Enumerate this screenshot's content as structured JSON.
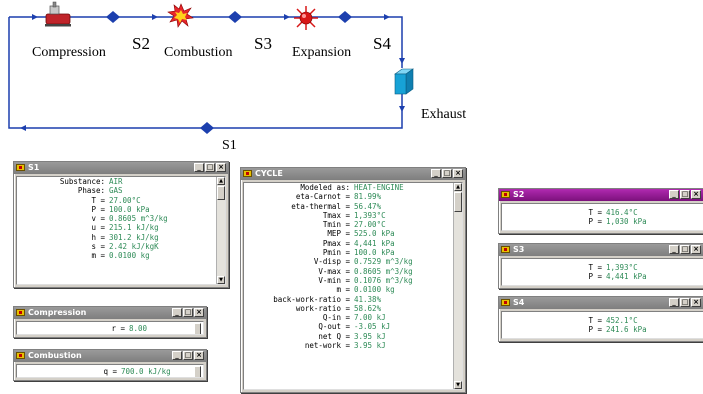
{
  "diagram": {
    "labels": {
      "compression": "Compression",
      "s2": "S2",
      "combustion": "Combustion",
      "s3": "S3",
      "expansion": "Expansion",
      "s4": "S4",
      "exhaust": "Exhaust",
      "s1": "S1"
    },
    "colors": {
      "line": "#1c3fae",
      "node": "#1c3fae",
      "compressor": "#c0242a",
      "exhaust": "#17a2d6"
    }
  },
  "windows": {
    "s1": {
      "title": "S1",
      "rows": [
        {
          "label": "Substance:",
          "value": "AIR"
        },
        {
          "label": "Phase:",
          "value": "GAS"
        },
        {
          "label": "T =",
          "value": "27.00°C"
        },
        {
          "label": "P =",
          "value": "100.0 kPa"
        },
        {
          "label": "v =",
          "value": "0.8605 m^3/kg"
        },
        {
          "label": "u =",
          "value": "215.1 kJ/kg"
        },
        {
          "label": "h =",
          "value": "301.2 kJ/kg"
        },
        {
          "label": "s =",
          "value": "2.42 kJ/kgK"
        },
        {
          "label": "m =",
          "value": "0.0100 kg"
        }
      ]
    },
    "compression": {
      "title": "Compression",
      "rows": [
        {
          "label": "r =",
          "value": "8.00"
        }
      ]
    },
    "combustion": {
      "title": "Combustion",
      "rows": [
        {
          "label": "q =",
          "value": "700.0 kJ/kg"
        }
      ]
    },
    "cycle": {
      "title": "CYCLE",
      "rows": [
        {
          "label": "Modeled as:",
          "value": "HEAT-ENGINE"
        },
        {
          "label": "eta-Carnot =",
          "value": "81.99%"
        },
        {
          "label": "eta-thermal =",
          "value": "56.47%"
        },
        {
          "label": "Tmax =",
          "value": "1,393°C"
        },
        {
          "label": "Tmin =",
          "value": "27.00°C"
        },
        {
          "label": "MEP =",
          "value": "525.0 kPa"
        },
        {
          "label": "Pmax =",
          "value": "4,441 kPa"
        },
        {
          "label": "Pmin =",
          "value": "100.0 kPa"
        },
        {
          "label": "V-disp =",
          "value": "0.7529 m^3/kg"
        },
        {
          "label": "V-max =",
          "value": "0.8605 m^3/kg"
        },
        {
          "label": "V-min =",
          "value": "0.1076 m^3/kg"
        },
        {
          "label": "m =",
          "value": "0.0100 kg"
        },
        {
          "label": "back-work-ratio =",
          "value": "41.38%"
        },
        {
          "label": "work-ratio =",
          "value": "58.62%"
        },
        {
          "label": "Q-in =",
          "value": "7.00 kJ"
        },
        {
          "label": "Q-out =",
          "value": "-3.05 kJ"
        },
        {
          "label": "net Q =",
          "value": "3.95 kJ"
        },
        {
          "label": "net-work =",
          "value": "3.95 kJ"
        }
      ]
    },
    "s2": {
      "title": "S2",
      "rows": [
        {
          "label": "T =",
          "value": "416.4°C"
        },
        {
          "label": "P =",
          "value": "1,030 kPa"
        }
      ]
    },
    "s3": {
      "title": "S3",
      "rows": [
        {
          "label": "T =",
          "value": "1,393°C"
        },
        {
          "label": "P =",
          "value": "4,441 kPa"
        }
      ]
    },
    "s4": {
      "title": "S4",
      "rows": [
        {
          "label": "T =",
          "value": "452.1°C"
        },
        {
          "label": "P =",
          "value": "241.6 kPa"
        }
      ]
    }
  },
  "colors": {
    "value_text": "#2e8b57",
    "active_title": "#9c1c9c",
    "inactive_title": "#8c8c8c"
  }
}
